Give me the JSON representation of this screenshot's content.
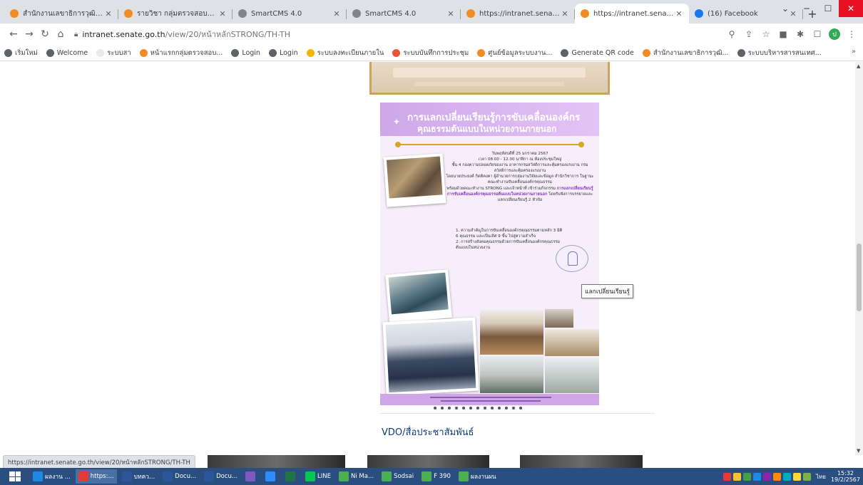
{
  "browser": {
    "tabs": [
      {
        "title": "สำนักงานเลขาธิการวุฒิสภา",
        "favicon_color": "#f28b20",
        "active": false
      },
      {
        "title": "รายวิชา กลุ่มตรวจสอบการ...",
        "favicon_color": "#f28b20",
        "active": false
      },
      {
        "title": "SmartCMS 4.0",
        "favicon_color": "#80868b",
        "active": false
      },
      {
        "title": "SmartCMS 4.0",
        "favicon_color": "#80868b",
        "active": false
      },
      {
        "title": "https://intranet.senate.go...",
        "favicon_color": "#f28b20",
        "active": false
      },
      {
        "title": "https://intranet.senate.g",
        "favicon_color": "#f28b20",
        "active": true
      },
      {
        "title": "(16) Facebook",
        "favicon_color": "#1877f2",
        "active": false
      }
    ],
    "new_tab_label": "+",
    "url_host": "intranet.senate.go.th",
    "url_path": "/view/20/หน้าหลักSTRONG/TH-TH",
    "bookmarks": [
      {
        "label": "เริ่มใหม่",
        "color": "#5f6368"
      },
      {
        "label": "Welcome",
        "color": "#5f6368"
      },
      {
        "label": "ระบบสา",
        "color": "#e8eaed"
      },
      {
        "label": "หน้าแรกกลุ่มตรวจสอบ...",
        "color": "#f28b20"
      },
      {
        "label": "Login",
        "color": "#5f6368"
      },
      {
        "label": "Login",
        "color": "#5f6368"
      },
      {
        "label": "ระบบลงทะเบียนภายใน",
        "color": "#f5b400"
      },
      {
        "label": "ระบบบันทึกการประชุม",
        "color": "#e8553b"
      },
      {
        "label": "ศูนย์ข้อมูลระบบงาน...",
        "color": "#f28b20"
      },
      {
        "label": "Generate QR code",
        "color": "#5f6368"
      },
      {
        "label": "สำนักงานเลขาธิการวุฒิ...",
        "color": "#f28b20"
      },
      {
        "label": "ระบบบริหารสารสนเทศ...",
        "color": "#5f6368"
      }
    ],
    "bookmarks_more": "»",
    "profile_initial": "ป"
  },
  "page": {
    "poster": {
      "title_line1": "การแลกเปลี่ยนเรียนรู้การขับเคลื่อนองค์กร",
      "title_line2": "คุณธรรมต้นแบบในหน่วยงานภายนอก",
      "date_line": "วันพฤหัสบดีที่ 25 มกราคม 2567",
      "time_line": "เวลา 08.00 - 12.00 นาฬิกา ณ ห้องประชุมใหญ่",
      "body_1": "ชั้น 4 กองความปลอดภัยของงาน อาคารกรมสวัสดิการและคุ้มครองแรงงาน กรมสวัสดิการและคุ้มครองแรงงาน",
      "body_2": "โดยนายประยงค์ กิตติคงคา ผู้อำนวยการกลุ่มงานวิจัยและข้อมูล สำนักวิชาการ ในฐานะคณะทำงานขับเคลื่อนองค์กรคุณธรรม",
      "body_3": "พร้อมด้วยคณะทำงาน STRONG และเจ้าหน้าที่ เข้าร่วมกิจกรรม",
      "highlight": "การแลกเปลี่ยนเรียนรู้การขับเคลื่อนองค์กรคุณธรรมต้นแบบในหน่วยงานภายนอก",
      "body_4": "โดยรับฟังการบรรยายและแลกเปลี่ยนเรียนรู้ 2 หัวข้อ",
      "item_1": "1. ความสำคัญในการขับเคลื่อนองค์กรคุณธรรมตามหลัก 3 มิติ 6 คุณธรรม และเป็นเลิศ 9 ขั้น ไปสู่ความสำเร็จ",
      "item_2": "2. การสร้างสังคมคุณธรรมด้วยการขับเคลื่อนองค์กรคุณธรรมต้นแบบในหน่วยงาน"
    },
    "tooltip": "แลกเปลี่ยนเรียนรู้",
    "carousel_dots": 13,
    "section_title": "VDO/สื่อประชาสัมพันธ์",
    "status_url": "https://intranet.senate.go.th/view/20/หน้าหลักSTRONG/TH-TH"
  },
  "taskbar": {
    "buttons": [
      {
        "label": "ผลงาน ...",
        "icon": "ie-icon",
        "color": "#1e88e5",
        "selected": false
      },
      {
        "label": "https:...",
        "icon": "chrome-icon",
        "color": "#e53935",
        "selected": true
      },
      {
        "label": "บทคว...",
        "icon": "word-icon",
        "color": "#2b579a",
        "selected": false
      },
      {
        "label": "Docu...",
        "icon": "word-icon",
        "color": "#2b579a",
        "selected": false
      },
      {
        "label": "Docu...",
        "icon": "word-icon",
        "color": "#2b579a",
        "selected": false
      },
      {
        "label": "",
        "icon": "app-icon",
        "color": "#7e57c2",
        "selected": false
      },
      {
        "label": "",
        "icon": "zoom-icon",
        "color": "#2d8cff",
        "selected": false
      },
      {
        "label": "",
        "icon": "excel-icon",
        "color": "#217346",
        "selected": false
      },
      {
        "label": "LINE",
        "icon": "line-icon",
        "color": "#06c755",
        "selected": false
      },
      {
        "label": "Ni Ma...",
        "icon": "person-icon",
        "color": "#4caf50",
        "selected": false
      },
      {
        "label": "Sodsai",
        "icon": "person-icon",
        "color": "#4caf50",
        "selected": false
      },
      {
        "label": "F 390",
        "icon": "person-icon",
        "color": "#4caf50",
        "selected": false
      },
      {
        "label": "ผลงานผน",
        "icon": "group-icon",
        "color": "#4caf50",
        "selected": false
      }
    ],
    "time": "15:32",
    "date": "19/2/2567",
    "lang": "ไทย"
  }
}
